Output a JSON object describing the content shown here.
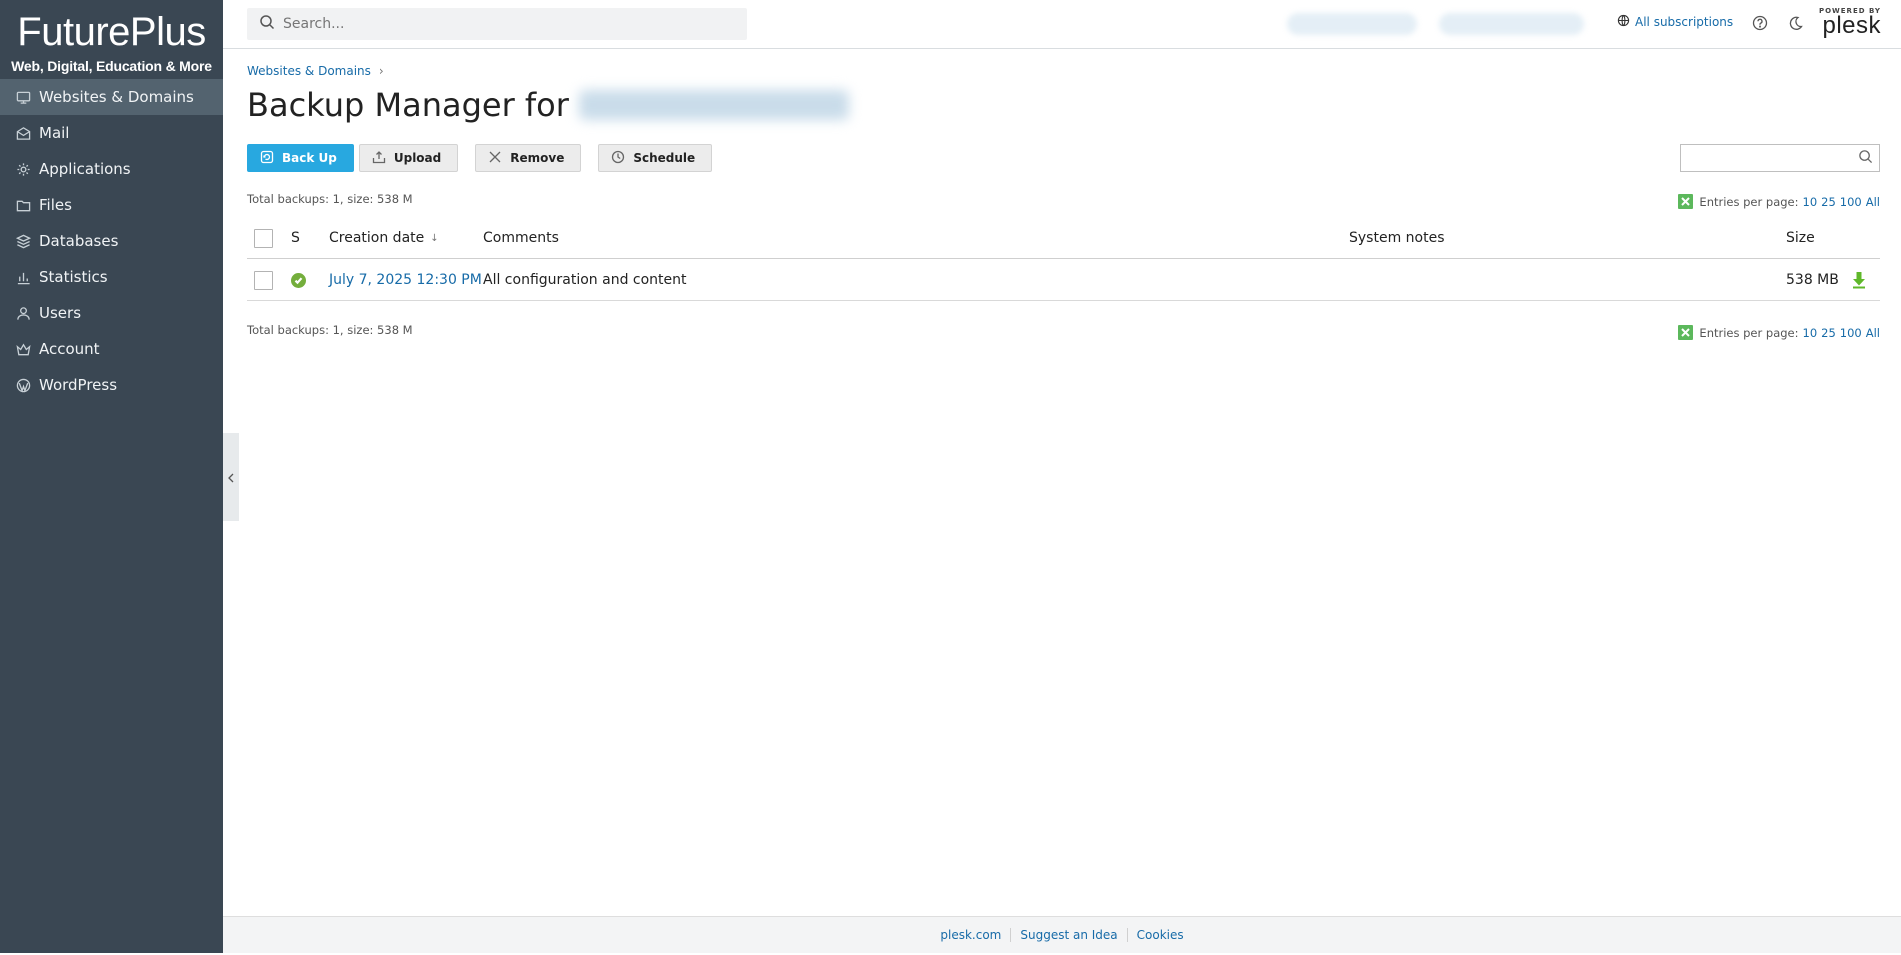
{
  "brand": {
    "name": "FuturePlus",
    "tagline": "Web, Digital, Education & More"
  },
  "sidebar": {
    "items": [
      {
        "label": "Websites & Domains",
        "icon": "monitor-icon",
        "active": true
      },
      {
        "label": "Mail",
        "icon": "mail-icon"
      },
      {
        "label": "Applications",
        "icon": "gear-icon"
      },
      {
        "label": "Files",
        "icon": "folder-icon"
      },
      {
        "label": "Databases",
        "icon": "database-icon"
      },
      {
        "label": "Statistics",
        "icon": "bar-chart-icon"
      },
      {
        "label": "Users",
        "icon": "user-icon"
      },
      {
        "label": "Account",
        "icon": "crown-icon"
      },
      {
        "label": "WordPress",
        "icon": "wordpress-icon"
      }
    ]
  },
  "header": {
    "search_placeholder": "Search...",
    "subscriptions_label": "All subscriptions",
    "powered_by": "POWERED BY",
    "powered_brand": "plesk"
  },
  "breadcrumb": {
    "item": "Websites & Domains"
  },
  "page": {
    "title": "Backup Manager for"
  },
  "toolbar": {
    "backup_label": "Back Up",
    "upload_label": "Upload",
    "remove_label": "Remove",
    "schedule_label": "Schedule"
  },
  "list": {
    "summary": "Total backups: 1, size: 538 M",
    "entries_label": "Entries per page:",
    "page_sizes": [
      "10",
      "25",
      "100",
      "All"
    ],
    "columns": {
      "status": "S",
      "creation_date": "Creation date",
      "comments": "Comments",
      "system_notes": "System notes",
      "size": "Size"
    },
    "rows": [
      {
        "creation_date": "July 7, 2025 12:30 PM",
        "comments": "All configuration and content",
        "system_notes": "",
        "size": "538 MB",
        "status": "ok"
      }
    ]
  },
  "footer": {
    "links": [
      "plesk.com",
      "Suggest an Idea",
      "Cookies"
    ]
  },
  "colors": {
    "sidebar_bg": "#3a4753",
    "primary": "#28a8e0",
    "link": "#176ba8",
    "success": "#74ae3c",
    "download": "#5fb82a"
  }
}
